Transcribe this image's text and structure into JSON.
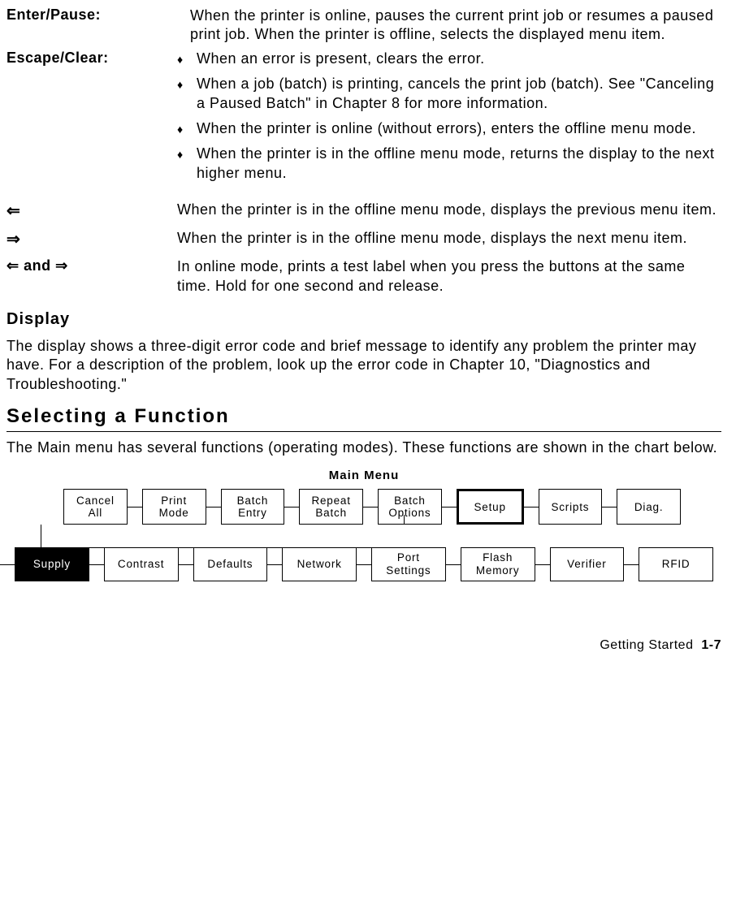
{
  "definitions": {
    "enter_pause": {
      "term": "Enter/Pause:",
      "desc": "When the printer is online, pauses the current print job or resumes a paused print job. When the printer is offline, selects the displayed menu item."
    },
    "escape_clear": {
      "term": "Escape/Clear:",
      "bullets": [
        "When an error is present, clears the error.",
        "When a job (batch) is printing, cancels the print job (batch).  See \"Canceling a Paused Batch\" in Chapter 8 for more information.",
        "When the printer is online (without errors), enters the offline menu mode.",
        "When the printer is in the offline menu mode, returns the display to the next higher menu."
      ]
    },
    "left_arrow": {
      "symbol": "⇐",
      "desc": "When the printer is in the offline menu mode, displays the previous menu item."
    },
    "right_arrow": {
      "symbol": "⇒",
      "desc": "When the printer is in the offline menu mode, displays the next menu item."
    },
    "both_arrows": {
      "symbol": "⇐ and ⇒",
      "desc": "In online mode, prints a test label when you press the buttons at the same time.  Hold for one second and release."
    }
  },
  "display_section": {
    "heading": "Display",
    "body": "The display shows a three-digit error code and brief message to identify any problem the printer may have.  For a description of the problem, look up the error code in Chapter 10, \"Diagnostics and Troubleshooting.\""
  },
  "selecting_section": {
    "heading": "Selecting a Function",
    "body": "The Main menu has several functions (operating modes).  These functions are shown in the chart below."
  },
  "chart": {
    "title": "Main Menu",
    "row1": [
      {
        "label": "Cancel\nAll"
      },
      {
        "label": "Print\nMode"
      },
      {
        "label": "Batch\nEntry"
      },
      {
        "label": "Repeat\nBatch"
      },
      {
        "label": "Batch\nOptions"
      },
      {
        "label": "Setup",
        "selected": true
      },
      {
        "label": "Scripts"
      },
      {
        "label": "Diag."
      }
    ],
    "row2": [
      {
        "label": "Supply",
        "inverted": true
      },
      {
        "label": "Contrast"
      },
      {
        "label": "Defaults"
      },
      {
        "label": "Network"
      },
      {
        "label": "Port\nSettings"
      },
      {
        "label": "Flash\nMemory"
      },
      {
        "label": "Verifier"
      },
      {
        "label": "RFID"
      }
    ]
  },
  "footer": {
    "section": "Getting Started",
    "page": "1-7"
  },
  "chart_data": {
    "type": "tree",
    "title": "Main Menu",
    "root": "Main Menu",
    "children": [
      "Cancel All",
      "Print Mode",
      "Batch Entry",
      "Repeat Batch",
      "Batch Options",
      "Setup",
      "Scripts",
      "Diag."
    ],
    "selected_child": "Setup",
    "setup_children": [
      "Supply",
      "Contrast",
      "Defaults",
      "Network",
      "Port Settings",
      "Flash Memory",
      "Verifier",
      "RFID"
    ],
    "highlighted_leaf": "Supply"
  }
}
